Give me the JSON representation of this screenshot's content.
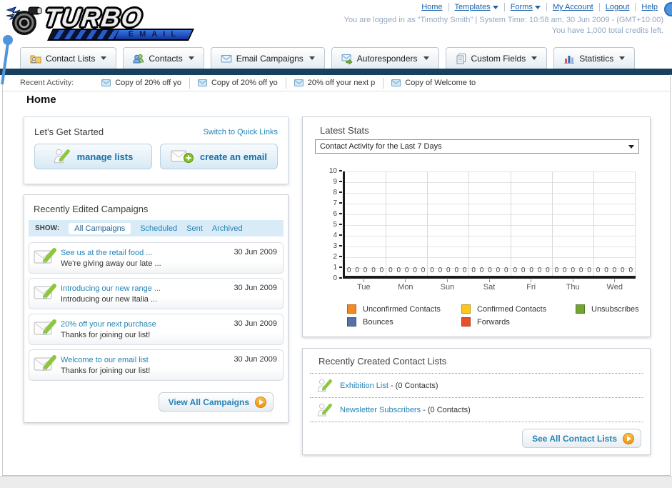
{
  "header": {
    "logo": {
      "title": "TURBO",
      "subtitle": "EMAIL"
    },
    "links": [
      {
        "label": "Home",
        "dropdown": false
      },
      {
        "label": "Templates",
        "dropdown": true
      },
      {
        "label": "Forms",
        "dropdown": true
      },
      {
        "label": "My Account",
        "dropdown": false
      },
      {
        "label": "Logout",
        "dropdown": false
      },
      {
        "label": "Help",
        "dropdown": false
      }
    ],
    "session_line": "You are logged in as \"Timothy Smith\" | System Time: 10:58 am, 30 Jun 2009 - (GMT+10:00)",
    "credits_line": "You have 1,000 total credits left."
  },
  "nav": {
    "items": [
      {
        "label": "Contact Lists"
      },
      {
        "label": "Contacts"
      },
      {
        "label": "Email Campaigns"
      },
      {
        "label": "Autoresponders"
      },
      {
        "label": "Custom Fields"
      },
      {
        "label": "Statistics"
      }
    ]
  },
  "recent_activity": {
    "label": "Recent Activity:",
    "items": [
      "Copy of 20% off yo",
      "Copy of 20% off yo",
      "20% off your next p",
      "Copy of Welcome to"
    ]
  },
  "home": {
    "title": "Home"
  },
  "get_started": {
    "title": "Let's Get Started",
    "switch_link": "Switch to Quick Links",
    "manage_lists_label": "manage lists",
    "create_email_label": "create an email"
  },
  "campaigns": {
    "title": "Recently Edited Campaigns",
    "show_label": "SHOW:",
    "tabs": [
      {
        "label": "All Campaigns",
        "active": true
      },
      {
        "label": "Scheduled",
        "active": false
      },
      {
        "label": "Sent",
        "active": false
      },
      {
        "label": "Archived",
        "active": false
      }
    ],
    "items": [
      {
        "title": "See us at the retail food ...",
        "subtitle": "We're giving away our late ...",
        "date": "30 Jun 2009"
      },
      {
        "title": "Introducing our new range ...",
        "subtitle": "Introducing our new Italia ...",
        "date": "30 Jun 2009"
      },
      {
        "title": "20% off your next purchase",
        "subtitle": "Thanks for joining our list!",
        "date": "30 Jun 2009"
      },
      {
        "title": "Welcome to our email list",
        "subtitle": "Thanks for joining our list!",
        "date": "30 Jun 2009"
      }
    ],
    "view_all_label": "View All Campaigns"
  },
  "stats": {
    "title": "Latest Stats",
    "selector_value": "Contact Activity for the Last 7 Days"
  },
  "chart_data": {
    "type": "bar",
    "title": "Contact Activity for the Last 7 Days",
    "categories": [
      "Tue",
      "Mon",
      "Sun",
      "Sat",
      "Fri",
      "Thu",
      "Wed"
    ],
    "series": [
      {
        "name": "Unconfirmed Contacts",
        "color": "#f5891f",
        "values": [
          0,
          0,
          0,
          0,
          0,
          0,
          0
        ]
      },
      {
        "name": "Confirmed Contacts",
        "color": "#fbc81a",
        "values": [
          0,
          0,
          0,
          0,
          0,
          0,
          0
        ]
      },
      {
        "name": "Unsubscribes",
        "color": "#72a532",
        "values": [
          0,
          0,
          0,
          0,
          0,
          0,
          0
        ]
      },
      {
        "name": "Bounces",
        "color": "#5572a7",
        "values": [
          0,
          0,
          0,
          0,
          0,
          0,
          0
        ]
      },
      {
        "name": "Forwards",
        "color": "#e8502a",
        "values": [
          0,
          0,
          0,
          0,
          0,
          0,
          0
        ]
      }
    ],
    "ylim": [
      0,
      10
    ],
    "grid": true,
    "legend_position": "bottom"
  },
  "contact_lists": {
    "title": "Recently Created Contact Lists",
    "items": [
      {
        "name": "Exhibition List",
        "suffix": "- (0 Contacts)"
      },
      {
        "name": "Newsletter Subscribers",
        "suffix": "- (0 Contacts)"
      }
    ],
    "see_all_label": "See All Contact Lists"
  }
}
